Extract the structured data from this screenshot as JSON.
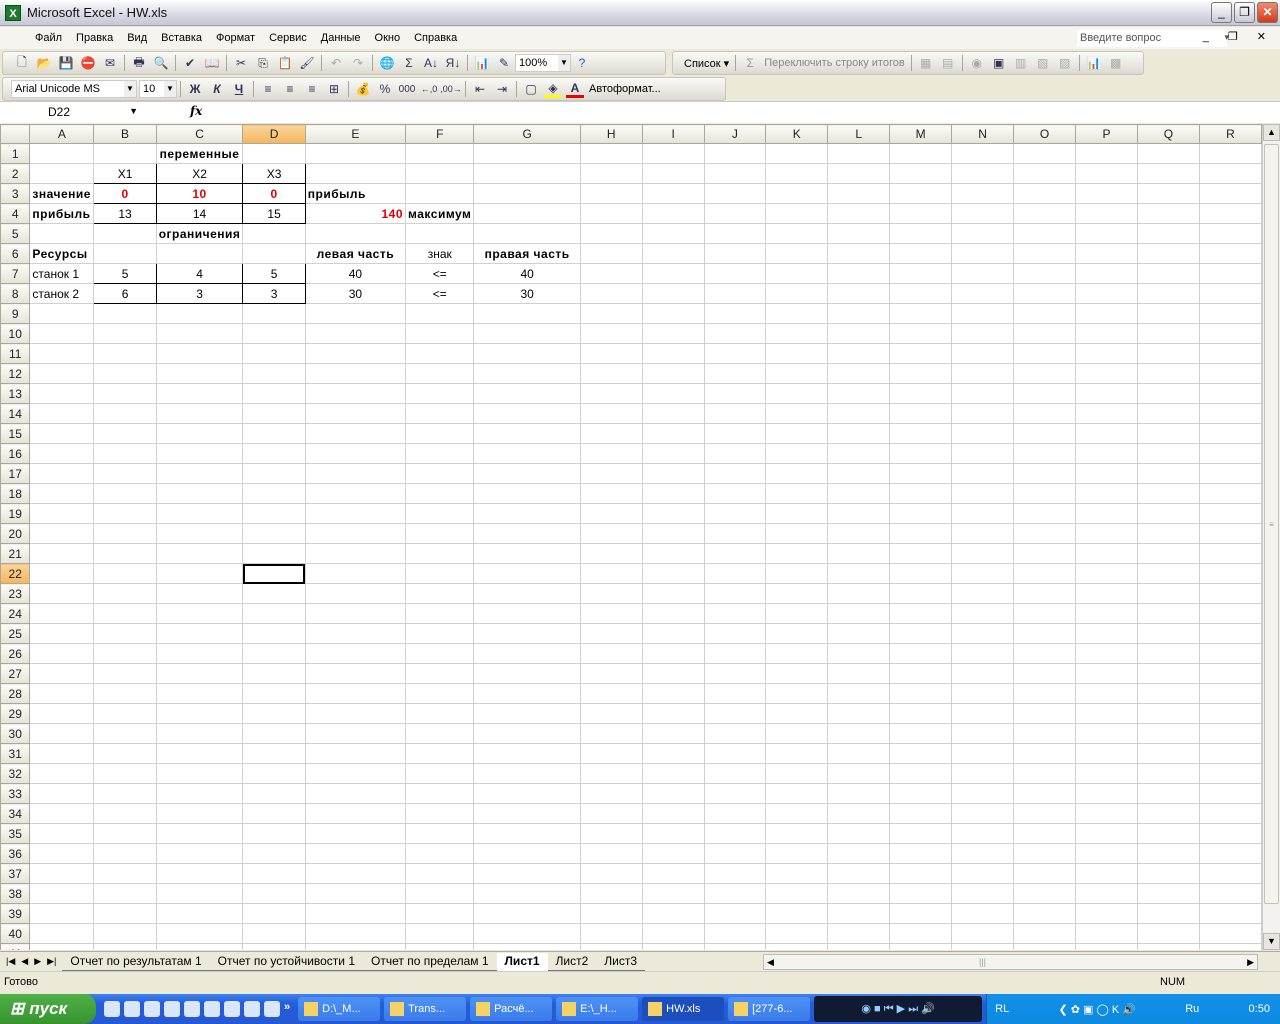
{
  "window": {
    "title": "Microsoft Excel - HW.xls",
    "app_icon": "excel-icon"
  },
  "menu": [
    "Файл",
    "Правка",
    "Вид",
    "Вставка",
    "Формат",
    "Сервис",
    "Данные",
    "Окно",
    "Справка"
  ],
  "ask_placeholder": "Введите вопрос",
  "toolbar": {
    "zoom": "100%",
    "list_label": "Список ▾",
    "toggle_totals": "Переключить строку итогов",
    "font": "Arial Unicode MS",
    "size": "10",
    "bold": "Ж",
    "italic": "К",
    "underline": "Ч",
    "percent": "%",
    "thousands": "000",
    "autoformat": "Автоформат...",
    "sum": "Σ"
  },
  "formula_bar": {
    "name_box": "D22",
    "fx": "fx",
    "formula": ""
  },
  "columns": [
    "A",
    "B",
    "C",
    "D",
    "E",
    "F",
    "G",
    "H",
    "I",
    "J",
    "K",
    "L",
    "M",
    "N",
    "O",
    "P",
    "Q",
    "R"
  ],
  "selected_column": "D",
  "selected_row": 22,
  "active_cell": "D22",
  "rows_visible": 41,
  "cells": {
    "C1": "переменные",
    "B2": "X1",
    "C2": "X2",
    "D2": "X3",
    "A3": "значение",
    "B3": "0",
    "C3": "10",
    "D3": "0",
    "E3": "прибыль",
    "A4": "прибыль",
    "B4": "13",
    "C4": "14",
    "D4": "15",
    "E4": "140",
    "F4": "максимум",
    "C5": "ограничения",
    "A6": "Ресурсы",
    "E6": "левая часть",
    "F6": "знак",
    "G6": "правая часть",
    "A7": "станок 1",
    "B7": "5",
    "C7": "4",
    "D7": "5",
    "E7": "40",
    "F7": "<=",
    "G7": "40",
    "A8": "станок 2",
    "B8": "6",
    "C8": "3",
    "D8": "3",
    "E8": "30",
    "F8": "<=",
    "G8": "30"
  },
  "sheet_tabs": [
    "Отчет по результатам 1",
    "Отчет по устойчивости 1",
    "Отчет по пределам 1",
    "Лист1",
    "Лист2",
    "Лист3"
  ],
  "active_tab": "Лист1",
  "status": {
    "ready": "Готово",
    "num": "NUM"
  },
  "taskbar": {
    "start": "пуск",
    "tasks": [
      "D:\\_M...",
      "Trans...",
      "Расчё...",
      "E:\\_H...",
      "HW.xls",
      "[277-6..."
    ],
    "active_task": "HW.xls",
    "lang": "Ru",
    "layout": "RL",
    "clock": "0:50"
  }
}
